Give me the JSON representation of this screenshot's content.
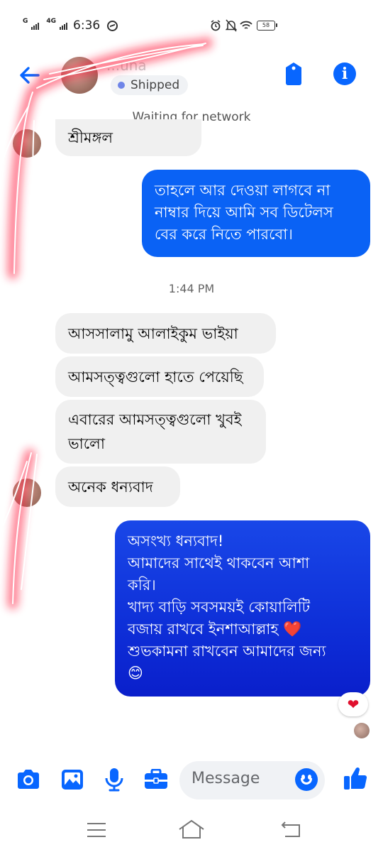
{
  "status_bar": {
    "network_1": "G",
    "network_2": "4G",
    "time": "6:36",
    "battery": "58"
  },
  "header": {
    "contact_name": "...una",
    "status_label": "Shipped"
  },
  "banner": "Waiting for network",
  "messages": [
    {
      "side": "in",
      "text": "শ্রীমঙ্গল"
    },
    {
      "side": "out",
      "lines": [
        "তাহলে আর দেওয়া লাগবে না",
        "নাম্বার দিয়ে আমি সব ডিটেলস",
        "বের করে নিতে পারবো।"
      ]
    },
    {
      "side": "time",
      "text": "1:44 PM"
    },
    {
      "side": "in",
      "text": "আসসালামু আলাইকুম ভাইয়া"
    },
    {
      "side": "in",
      "text": "আমসত্ত্বগুলো হাতে পেয়েছি"
    },
    {
      "side": "in",
      "lines": [
        "এবারের আমসত্ত্বগুলো খুবই",
        "ভালো"
      ]
    },
    {
      "side": "in",
      "text": "অনেক ধন্যবাদ"
    },
    {
      "side": "out",
      "lines": [
        "অসংখ্য ধন্যবাদ!",
        "আমাদের সাথেই থাকবেন আশা",
        "করি।",
        "খাদ্য বাড়ি সবসময়ই কোয়ালিটি",
        "বজায় রাখবে ইনশাআল্লাহ ❤️",
        "শুভকামনা রাখবেন আমাদের জন্য",
        "😊"
      ]
    }
  ],
  "reaction": "❤",
  "composer": {
    "placeholder": "Message"
  },
  "colors": {
    "accent": "#0866ff",
    "outgoing_1": "#0a62f5",
    "outgoing_2": "#1435de",
    "incoming": "#f0f0f0",
    "scribble": "#ff1e3c"
  }
}
